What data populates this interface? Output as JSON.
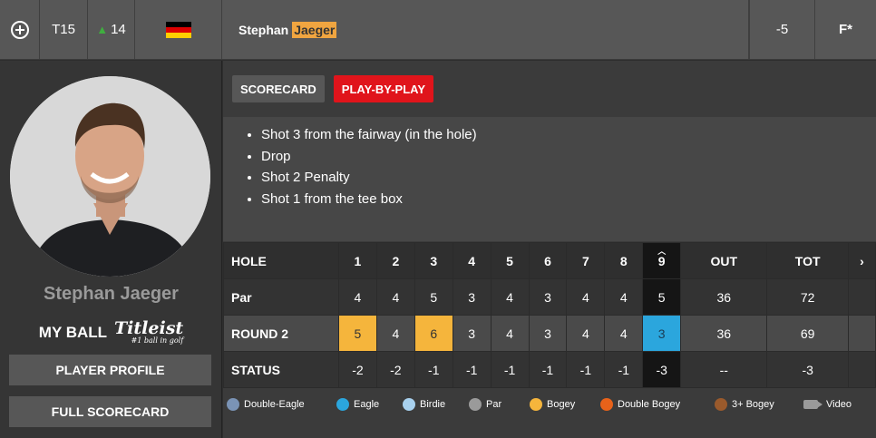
{
  "topbar": {
    "position": "T15",
    "movement": "14",
    "player_first": "Stephan",
    "player_last": "Jaeger",
    "score": "-5",
    "thru": "F*"
  },
  "left": {
    "player_name": "Stephan Jaeger",
    "my_ball": "MY BALL",
    "ball_brand": "Titleist",
    "ball_tagline": "#1 ball in golf",
    "player_profile_label": "PLAYER PROFILE",
    "full_scorecard_label": "FULL SCORECARD"
  },
  "tabs": {
    "scorecard": "SCORECARD",
    "play_by_play": "PLAY-BY-PLAY"
  },
  "play_by_play": [
    "Shot 3 from the fairway (in the hole)",
    "Drop",
    "Shot 2 Penalty",
    "Shot 1 from the tee box"
  ],
  "scorecard": {
    "labels": {
      "hole": "HOLE",
      "par": "Par",
      "round": "ROUND 2",
      "status": "STATUS"
    },
    "holes": [
      "1",
      "2",
      "3",
      "4",
      "5",
      "6",
      "7",
      "8",
      "9",
      "OUT",
      "TOT"
    ],
    "par": [
      "4",
      "4",
      "5",
      "3",
      "4",
      "3",
      "4",
      "4",
      "5",
      "36",
      "72"
    ],
    "round": [
      "5",
      "4",
      "6",
      "3",
      "4",
      "3",
      "4",
      "4",
      "3",
      "36",
      "69"
    ],
    "status": [
      "-2",
      "-2",
      "-1",
      "-1",
      "-1",
      "-1",
      "-1",
      "-1",
      "-3",
      "--",
      "-3"
    ]
  },
  "legend": [
    {
      "label": "Double-Eagle",
      "color": "#7a93b5"
    },
    {
      "label": "Eagle",
      "color": "#2ba6dd"
    },
    {
      "label": "Birdie",
      "color": "#a8d1ee"
    },
    {
      "label": "Par",
      "color": "#9a9a9a"
    },
    {
      "label": "Bogey",
      "color": "#f5b53c"
    },
    {
      "label": "Double Bogey",
      "color": "#e8621a"
    },
    {
      "label": "3+ Bogey",
      "color": "#9a5a2c"
    },
    {
      "label": "Video",
      "icon": "video-camera-icon"
    }
  ],
  "colors": {
    "accent_red": "#e0141b",
    "highlight": "#f0a540"
  }
}
